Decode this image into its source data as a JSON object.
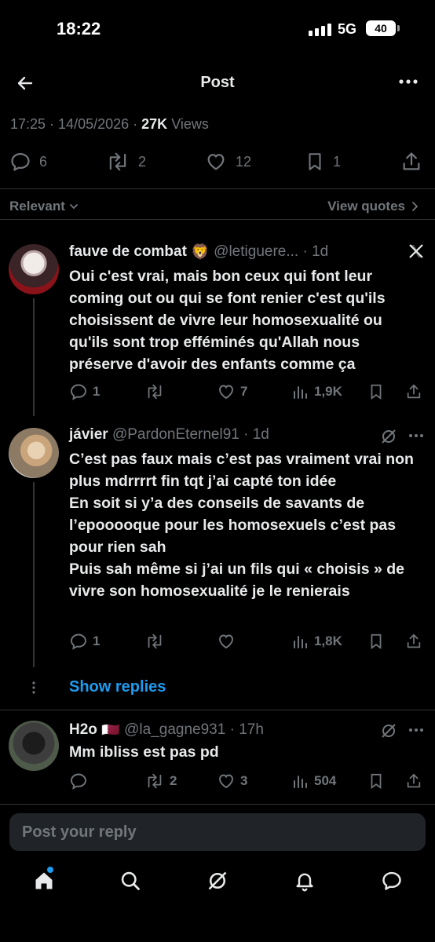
{
  "status_bar": {
    "time": "18:22",
    "network": "5G",
    "battery": "40"
  },
  "header": {
    "title": "Post"
  },
  "post_meta": {
    "time": "17:25",
    "date": "14/05/2026",
    "views_count": "27K",
    "views_label": "Views"
  },
  "post_actions": {
    "replies": "6",
    "reposts": "2",
    "likes": "12",
    "bookmarks": "1"
  },
  "sort": {
    "label": "Relevant",
    "view_quotes": "View quotes"
  },
  "replies": [
    {
      "name": "fauve de combat",
      "emoji": "🦁",
      "handle": "@letiguere...",
      "age": "1d",
      "text": "Oui c'est vrai, mais bon ceux qui font leur coming out ou qui se font renier c'est qu'ils choisissent de vivre leur homosexualité ou qu'ils sont trop efféminés qu'Allah nous préserve d'avoir des enfants comme ça",
      "stats": {
        "replies": "1",
        "reposts": "",
        "likes": "7",
        "views": "1,9K"
      }
    },
    {
      "name": "jávier",
      "handle": "@PardonEternel91",
      "age": "1d",
      "text_lines": [
        "C’est pas faux mais c’est pas vraiment vrai non plus mdrrrrt fin tqt j’ai capté ton idée",
        "En soit si y’a des conseils de savants de l’epooooque pour les homosexuels c’est pas pour rien sah",
        "Puis sah même si j’ai un fils qui « choisis » de vivre son homosexualité je le renierais"
      ],
      "stats": {
        "replies": "1",
        "reposts": "",
        "likes": "",
        "views": "1,8K"
      }
    },
    {
      "name": "H2o",
      "flag": "🇶🇦",
      "handle": "@la_gagne931",
      "age": "17h",
      "text": "Mm ibliss est pas pd",
      "stats": {
        "replies": "",
        "reposts": "2",
        "likes": "3",
        "views": "504"
      }
    }
  ],
  "show_replies": "Show replies",
  "reply_box": {
    "placeholder": "Post your reply"
  },
  "colors": {
    "background": "#000000",
    "text": "#e7e9ea",
    "muted": "#71767b",
    "accent": "#1d9bf0",
    "divider": "#2f3336"
  },
  "icons": [
    "back-arrow-icon",
    "more-icon",
    "reply-icon",
    "repost-icon",
    "like-icon",
    "bookmark-icon",
    "share-icon",
    "views-icon",
    "x-logo-icon",
    "grok-icon",
    "home-icon",
    "search-icon",
    "notifications-icon",
    "messages-icon"
  ]
}
